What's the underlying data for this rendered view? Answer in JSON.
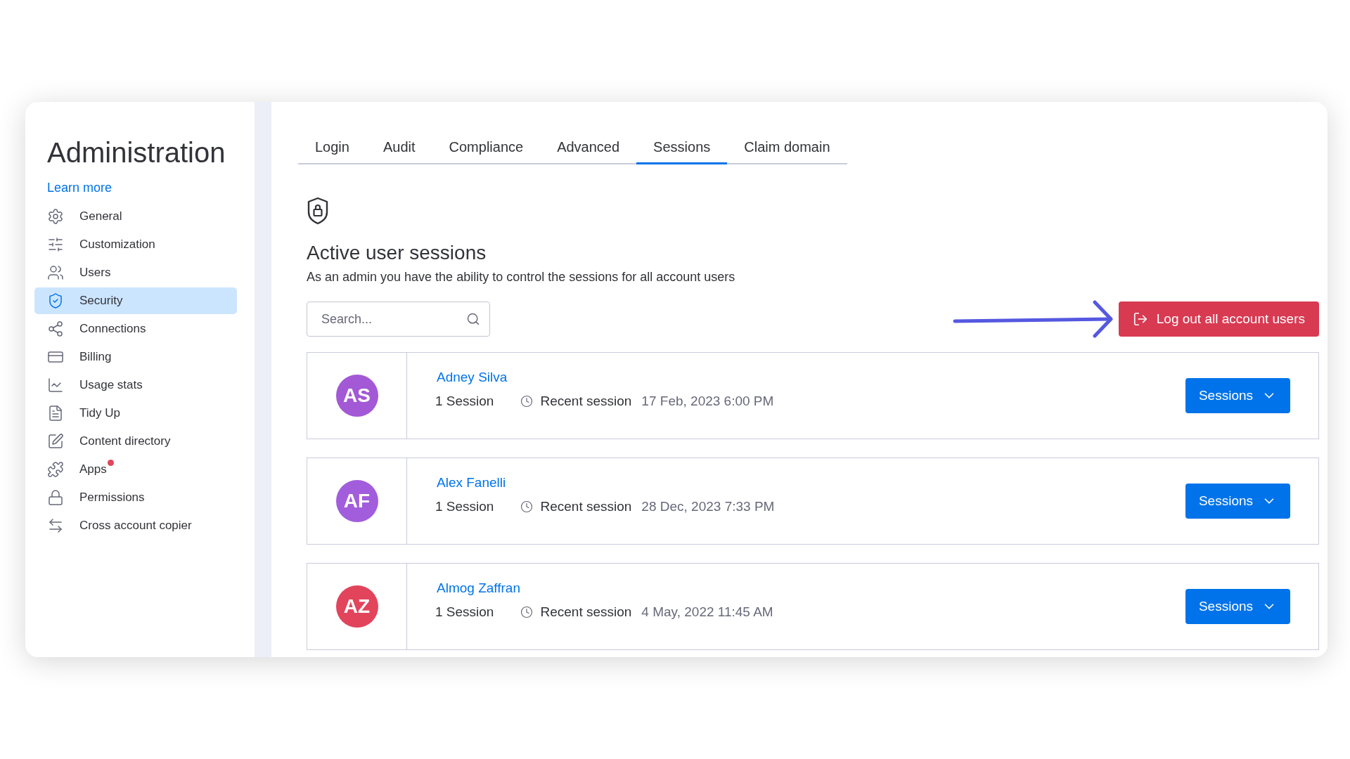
{
  "sidebar": {
    "title": "Administration",
    "link": "Learn more",
    "items": [
      {
        "label": "General",
        "selected": false,
        "notification": false
      },
      {
        "label": "Customization",
        "selected": false,
        "notification": false
      },
      {
        "label": "Users",
        "selected": false,
        "notification": false
      },
      {
        "label": "Security",
        "selected": true,
        "notification": false
      },
      {
        "label": "Connections",
        "selected": false,
        "notification": false
      },
      {
        "label": "Billing",
        "selected": false,
        "notification": false
      },
      {
        "label": "Usage stats",
        "selected": false,
        "notification": false
      },
      {
        "label": "Tidy Up",
        "selected": false,
        "notification": false
      },
      {
        "label": "Content directory",
        "selected": false,
        "notification": false
      },
      {
        "label": "Apps",
        "selected": false,
        "notification": true
      },
      {
        "label": "Permissions",
        "selected": false,
        "notification": false
      },
      {
        "label": "Cross account copier",
        "selected": false,
        "notification": false
      }
    ]
  },
  "tabs": [
    {
      "label": "Login",
      "selected": false
    },
    {
      "label": "Audit",
      "selected": false
    },
    {
      "label": "Compliance",
      "selected": false
    },
    {
      "label": "Advanced",
      "selected": false
    },
    {
      "label": "Sessions",
      "selected": true
    },
    {
      "label": "Claim domain",
      "selected": false
    }
  ],
  "section": {
    "title": "Active user sessions",
    "description": "As an admin you have the ability to control the sessions for all account users"
  },
  "search": {
    "placeholder": "Search..."
  },
  "logout_button": "Log out all account users",
  "users": [
    {
      "initials": "AS",
      "name": "Adney Silva",
      "sessions": "1 Session",
      "recent_label": "Recent session",
      "date": "17 Feb, 2023 6:00 PM",
      "color": "#a358d6",
      "button": "Sessions"
    },
    {
      "initials": "AF",
      "name": "Alex Fanelli",
      "sessions": "1 Session",
      "recent_label": "Recent session",
      "date": "28 Dec, 2023 7:33 PM",
      "color": "#a25ddc",
      "button": "Sessions"
    },
    {
      "initials": "AZ",
      "name": "Almog Zaffran",
      "sessions": "1 Session",
      "recent_label": "Recent session",
      "date": "4 May, 2022 11:45 AM",
      "color": "#e2445c",
      "button": "Sessions"
    }
  ]
}
